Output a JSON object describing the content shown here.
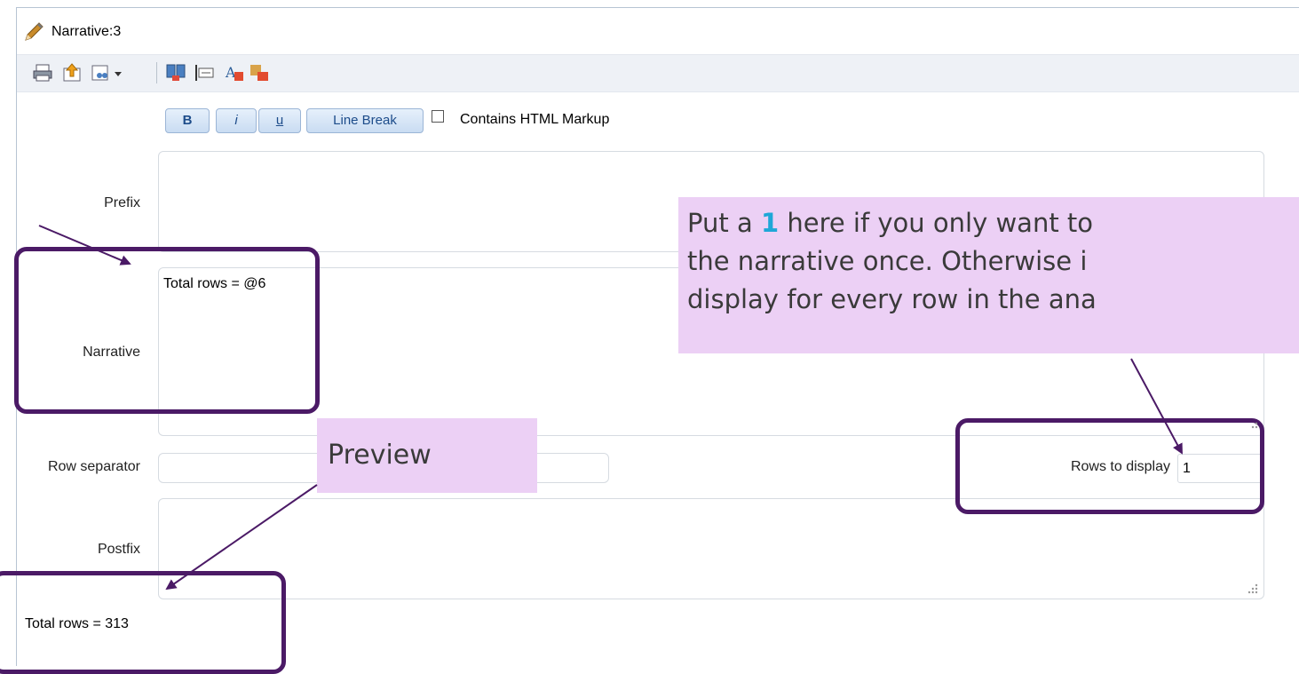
{
  "window": {
    "title": "Narrative:3"
  },
  "toolbar": {
    "icons": [
      "print-icon",
      "export-icon",
      "preview-icon",
      "columns-icon",
      "properties-icon",
      "text-format-icon",
      "clear-format-icon"
    ]
  },
  "format_bar": {
    "bold_label": "B",
    "italic_label": "i",
    "underline_label": "u",
    "line_break_label": "Line Break",
    "html_markup_label": "Contains HTML Markup",
    "html_markup_checked": false
  },
  "form": {
    "prefix_label": "Prefix",
    "prefix_value": "",
    "narrative_label": "Narrative",
    "narrative_value": "Total rows = @6",
    "row_separator_label": "Row separator",
    "row_separator_value": "",
    "rows_to_display_label": "Rows to display",
    "rows_to_display_value": "1",
    "postfix_label": "Postfix",
    "postfix_value": ""
  },
  "preview": {
    "text": "Total rows = 313"
  },
  "annotations": {
    "rows_callout_line1_a": "Put a ",
    "rows_callout_line1_num": "1",
    "rows_callout_line1_b": " here if you only want to",
    "rows_callout_line2": "the narrative once. Otherwise i",
    "rows_callout_line3": "display for every row in the ana",
    "preview_callout": "Preview",
    "highlight_color": "#4b1a66",
    "callout_bg": "#ecd0f5",
    "number_accent": "#1ea7d7"
  }
}
